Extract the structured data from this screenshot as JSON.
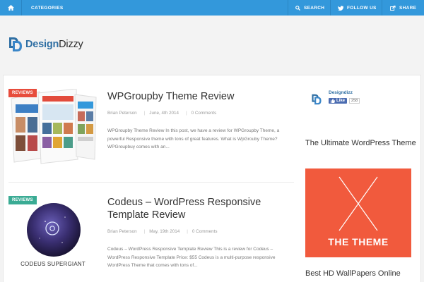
{
  "nav": {
    "categories": "CATEGORIES",
    "search": "SEARCH",
    "follow": "FOLLOW US",
    "share": "SHARE",
    "color": "#3398db"
  },
  "logo": {
    "part1": "Design",
    "part2": "Dizzy"
  },
  "posts": [
    {
      "badge": "REVIEWS",
      "badge_color": "#e74c3c",
      "title": "WPGroupby Theme Review",
      "author": "Brian Peterson",
      "date": "June, 4th 2014",
      "comments": "0 Comments",
      "excerpt": "WPGroupby Theme Review In this post, we have a review for WPGroupby Theme, a powerful Responsive theme with tons of great features. What is WpGrouby Theme? WPGroupbuy comes with an..."
    },
    {
      "badge": "REVIEWS",
      "badge_color": "#3aab94",
      "title": "Codeus – WordPress Responsive Template Review",
      "author": "Brian Peterson",
      "date": "May, 19th 2014",
      "comments": "0 Comments",
      "thumb_caption": "CODEUS SUPERGIANT",
      "excerpt": "Codeus – WordPress Responsive Template Review This is a review for Codeus – WordPress Responsive Template Price: $55 Codeus is a multi-purpose responsive WordPress Theme that comes with tons of..."
    }
  ],
  "sidebar": {
    "profile_name": "Designdizz",
    "like_label": "Like",
    "like_count": "258",
    "widget1_title": "The Ultimate WordPress Theme",
    "ad_text": "THE THEME",
    "widget2_title": "Best HD WallPapers Online"
  }
}
